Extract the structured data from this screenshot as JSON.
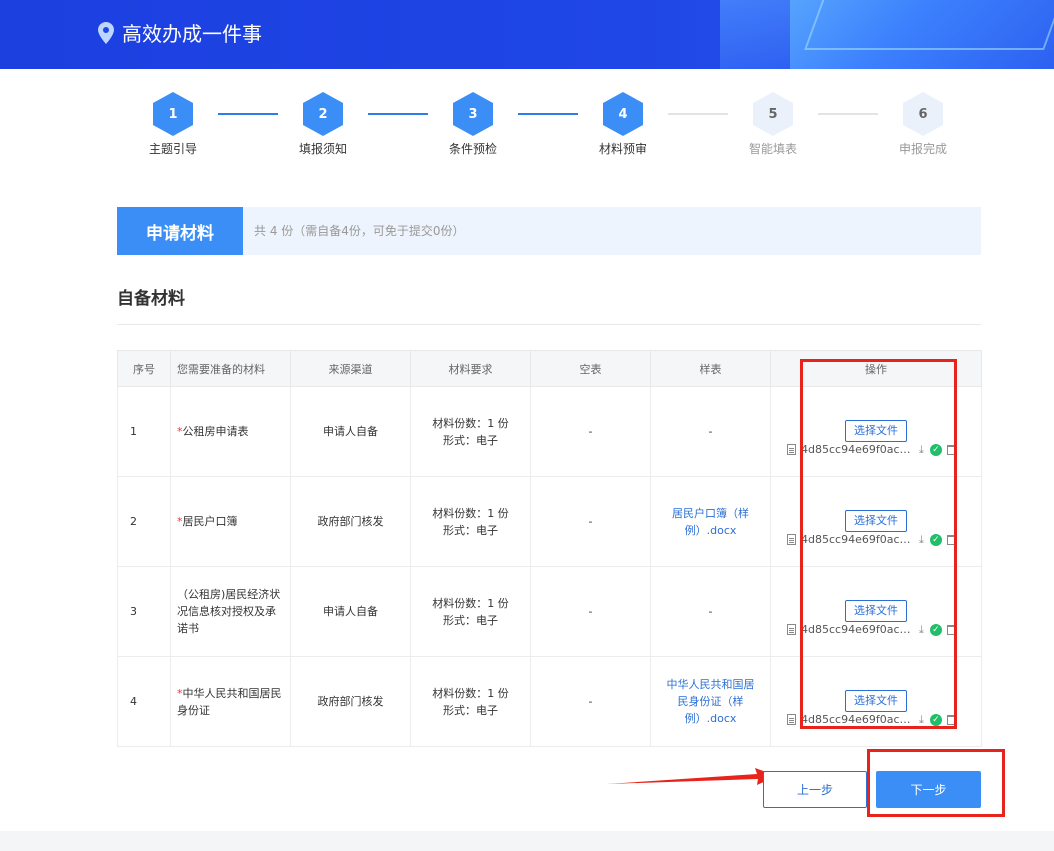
{
  "header": {
    "title": "高效办成一件事"
  },
  "steps": [
    {
      "num": "1",
      "label": "主题引导",
      "state": "active"
    },
    {
      "num": "2",
      "label": "填报须知",
      "state": "active"
    },
    {
      "num": "3",
      "label": "条件预检",
      "state": "active"
    },
    {
      "num": "4",
      "label": "材料预审",
      "state": "active"
    },
    {
      "num": "5",
      "label": "智能填表",
      "state": "inactive"
    },
    {
      "num": "6",
      "label": "申报完成",
      "state": "inactive"
    }
  ],
  "apply": {
    "tab_label": "申请材料",
    "summary": "共 4 份（需自备4份，可免于提交0份）"
  },
  "section": {
    "title": "自备材料"
  },
  "table": {
    "headers": [
      "序号",
      "您需要准备的材料",
      "来源渠道",
      "材料要求",
      "空表",
      "样表",
      "操作"
    ],
    "rows": [
      {
        "no": "1",
        "required_mark": "*",
        "name": "公租房申请表",
        "source": "申请人自备",
        "req_count": "材料份数：1 份",
        "req_form": "形式：电子",
        "blank": "-",
        "sample": "-",
        "choose": "选择文件",
        "file": "4d85cc94e69f0ace0c..."
      },
      {
        "no": "2",
        "required_mark": "*",
        "name": "居民户口簿",
        "source": "政府部门核发",
        "req_count": "材料份数：1 份",
        "req_form": "形式：电子",
        "blank": "-",
        "sample": "居民户口簿（样例）.docx",
        "choose": "选择文件",
        "file": "4d85cc94e69f0ace0c..."
      },
      {
        "no": "3",
        "required_mark": "",
        "name": "（公租房)居民经济状况信息核对授权及承诺书",
        "source": "申请人自备",
        "req_count": "材料份数：1 份",
        "req_form": "形式：电子",
        "blank": "-",
        "sample": "-",
        "choose": "选择文件",
        "file": "4d85cc94e69f0ace0c..."
      },
      {
        "no": "4",
        "required_mark": "*",
        "name": "中华人民共和国居民身份证",
        "source": "政府部门核发",
        "req_count": "材料份数：1 份",
        "req_form": "形式：电子",
        "blank": "-",
        "sample": "中华人民共和国居民身份证（样例）.docx",
        "choose": "选择文件",
        "file": "4d85cc94e69f0ace0c..."
      }
    ]
  },
  "buttons": {
    "prev": "上一步",
    "next": "下一步"
  },
  "colors": {
    "header": "#1f46e6",
    "accent": "#3a8ef5",
    "link": "#2b6fd6",
    "annotation": "#e8231b"
  }
}
